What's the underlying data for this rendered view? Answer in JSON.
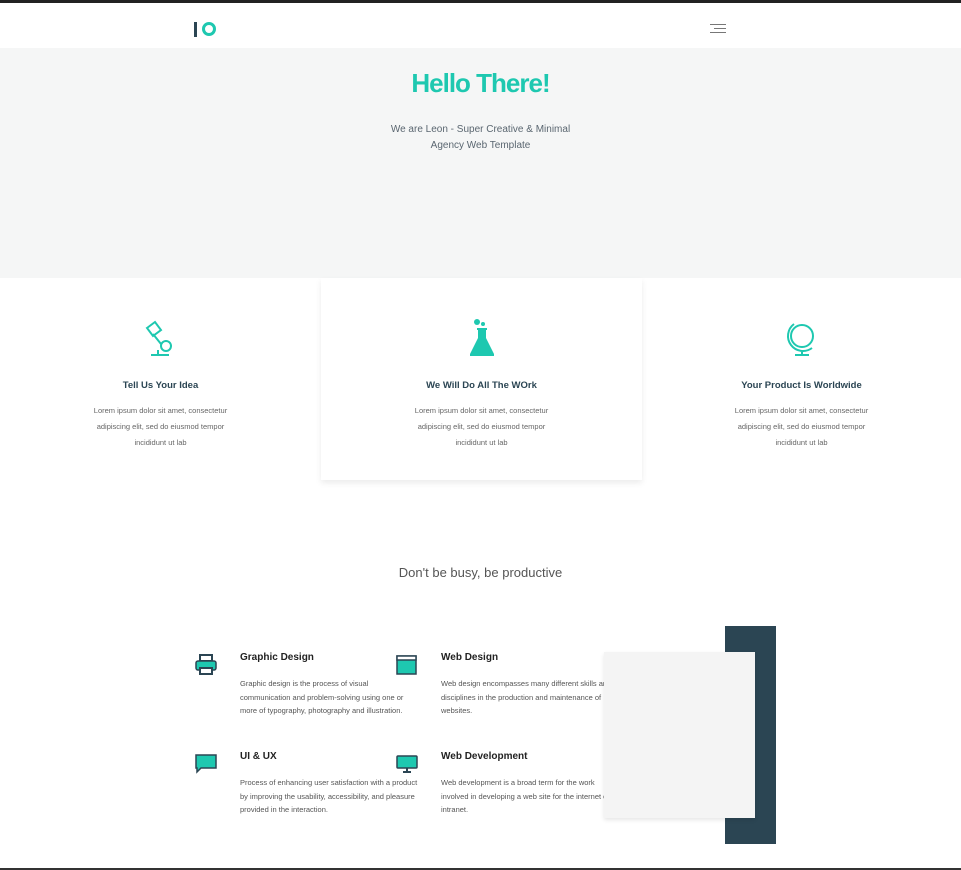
{
  "header": {
    "logo_text": "IO",
    "menu_icon": "hamburger-icon"
  },
  "hero": {
    "title": "Hello There!",
    "subtitle_line1": "We are Leon - Super Creative & Minimal",
    "subtitle_line2": "Agency  Web Template"
  },
  "features": [
    {
      "icon": "desk-lamp-icon",
      "title": "Tell Us Your Idea",
      "l1": "Lorem ipsum dolor sit amet, consectetur",
      "l2": "adipiscing elit, sed do eiusmod tempor",
      "l3": "incididunt ut lab"
    },
    {
      "icon": "flask-icon",
      "title": "We Will Do All The WOrk",
      "l1": "Lorem ipsum dolor sit amet, consectetur",
      "l2": "adipiscing elit, sed do eiusmod tempor",
      "l3": "incididunt ut lab"
    },
    {
      "icon": "globe-icon",
      "title": "Your Product Is Worldwide",
      "l1": "Lorem ipsum dolor sit amet, consectetur",
      "l2": "adipiscing elit, sed do eiusmod tempor",
      "l3": "incididunt ut lab"
    }
  ],
  "tagline": "Don't be busy, be productive",
  "services": [
    {
      "icon": "printer-icon",
      "title": "Graphic Design",
      "text": "Graphic design is the process of visual communication and problem-solving using one or more of typography, photography and illustration."
    },
    {
      "icon": "browser-window-icon",
      "title": "Web Design",
      "text": "Web design encompasses many different skills and disciplines in the production and maintenance of websites."
    },
    {
      "icon": "speech-bubble-icon",
      "title": "UI & UX",
      "text": "Process of enhancing user satisfaction with a product by improving the usability, accessibility, and pleasure provided in the interaction."
    },
    {
      "icon": "monitor-icon",
      "title": "Web Development",
      "text": "Web development is a broad term for the work involved in developing a web site for the internet or an intranet."
    }
  ],
  "colors": {
    "accent": "#1ec8b0",
    "dark": "#2b4553",
    "hero_bg": "#f5f6f6"
  }
}
